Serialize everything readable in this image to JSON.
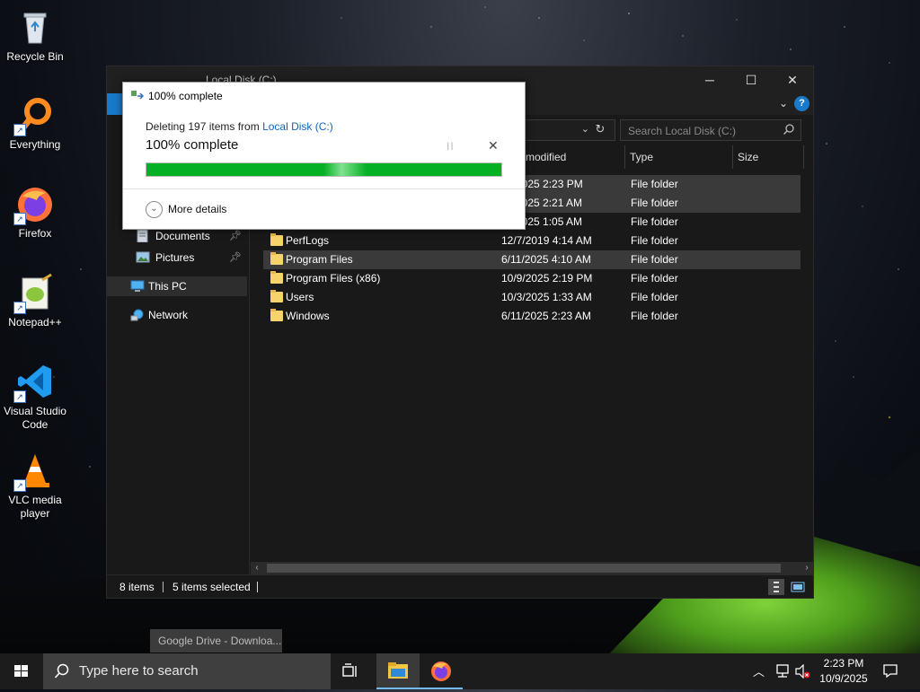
{
  "desktop": {
    "icons": [
      {
        "label": "Recycle Bin",
        "icon": "recycle-bin-icon"
      },
      {
        "label": "Everything",
        "icon": "everything-search-icon"
      },
      {
        "label": "Firefox",
        "icon": "firefox-icon"
      },
      {
        "label": "Notepad++",
        "icon": "notepad-plus-plus-icon"
      },
      {
        "label": "Visual Studio Code",
        "icon": "vscode-icon"
      },
      {
        "label": "VLC media player",
        "icon": "vlc-icon"
      }
    ]
  },
  "explorer": {
    "title": "Local Disk (C:)",
    "search_placeholder": "Search Local Disk (C:)",
    "columns": {
      "modified": "modified",
      "type": "Type",
      "size": "Size"
    },
    "nav": {
      "documents": "Documents",
      "pictures": "Pictures",
      "this_pc": "This PC",
      "network": "Network"
    },
    "rows": [
      {
        "name": "",
        "date": "2025 2:23 PM",
        "type": "File folder",
        "selected": true
      },
      {
        "name": "",
        "date": "2025 2:21 AM",
        "type": "File folder",
        "selected": true
      },
      {
        "name": "",
        "date": "2025 1:05 AM",
        "type": "File folder",
        "selected": false
      },
      {
        "name": "PerfLogs",
        "date": "12/7/2019 4:14 AM",
        "type": "File folder",
        "selected": false
      },
      {
        "name": "Program Files",
        "date": "6/11/2025 4:10 AM",
        "type": "File folder",
        "selected": true
      },
      {
        "name": "Program Files (x86)",
        "date": "10/9/2025 2:19 PM",
        "type": "File folder",
        "selected": false
      },
      {
        "name": "Users",
        "date": "10/3/2025 1:33 AM",
        "type": "File folder",
        "selected": false
      },
      {
        "name": "Windows",
        "date": "6/11/2025 2:23 AM",
        "type": "File folder",
        "selected": false
      }
    ],
    "status": {
      "items": "8 items",
      "selected": "5 items selected"
    }
  },
  "dialog": {
    "title": "100% complete",
    "deleting_prefix": "Deleting 197 items from ",
    "source_link": "Local Disk (C:)",
    "progress_text": "100% complete",
    "progress_fraction": 1.0,
    "more_details": "More details",
    "pause_glyph": "II",
    "close_glyph": "✕"
  },
  "taskbar": {
    "preview_label": "Google Drive - Downloa...",
    "search_placeholder": "Type here to search",
    "time": "2:23 PM",
    "date": "10/9/2025"
  },
  "colors": {
    "accent": "#1979ca",
    "progress": "#06b025",
    "folder": "#f7d36c"
  }
}
